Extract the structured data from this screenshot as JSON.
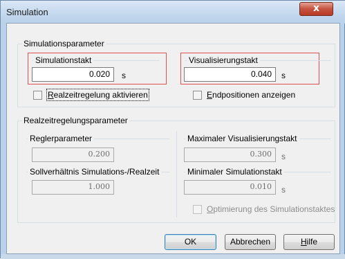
{
  "window": {
    "title": "Simulation",
    "close_label": "x"
  },
  "sim_params": {
    "legend": "Simulationsparameter",
    "simulationstakt": {
      "label": "Simulationstakt",
      "value": "0.020",
      "unit": "s"
    },
    "visualisierungstakt": {
      "label": "Visualisierungstakt",
      "value": "0.040",
      "unit": "s"
    },
    "echtzeit_check": {
      "first": "R",
      "rest": "ealzeitregelung aktivieren",
      "checked": false
    },
    "endpos_check": {
      "first": "E",
      "rest": "ndpositionen anzeigen",
      "checked": false
    }
  },
  "rt_params": {
    "legend": "Realzeitregelungsparameter",
    "reglerparameter": {
      "label": "Reglerparameter",
      "value": "0.200"
    },
    "sollverhaeltnis": {
      "label": "Sollverhältnis Simulations-/Realzeit",
      "value": "1.000"
    },
    "max_vis": {
      "label": "Maximaler Visualisierungstakt",
      "value": "0.300",
      "unit": "s"
    },
    "min_sim": {
      "label": "Minimaler Simulationstakt",
      "value": "0.010",
      "unit": "s"
    },
    "optimierung_check": {
      "first": "O",
      "rest": "ptimierung des Simulationstaktes",
      "checked": false
    }
  },
  "buttons": {
    "ok": "OK",
    "cancel": "Abbrechen",
    "help_first": "H",
    "help_rest": "ilfe"
  }
}
